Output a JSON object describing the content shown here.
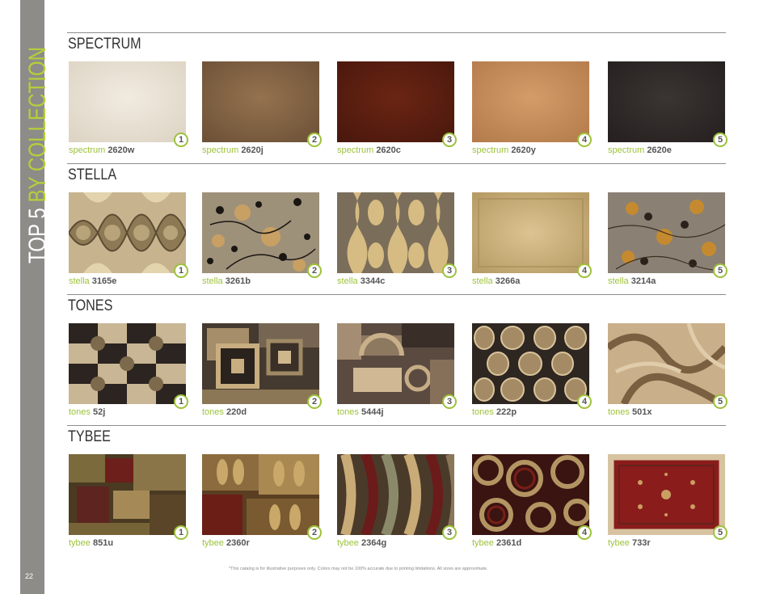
{
  "sidebar": {
    "title_part1": "TOP 5 ",
    "title_part2": "BY COLLECTION",
    "page_number": "22"
  },
  "sections": [
    {
      "title": "SPECTRUM",
      "items": [
        {
          "badge": "1",
          "collection": "spectrum",
          "sku": "2620w",
          "image": "cream-shag-rug"
        },
        {
          "badge": "2",
          "collection": "spectrum",
          "sku": "2620j",
          "image": "brown-shag-rug"
        },
        {
          "badge": "3",
          "collection": "spectrum",
          "sku": "2620c",
          "image": "rust-shag-rug"
        },
        {
          "badge": "4",
          "collection": "spectrum",
          "sku": "2620y",
          "image": "tan-shag-rug"
        },
        {
          "badge": "5",
          "collection": "spectrum",
          "sku": "2620e",
          "image": "charcoal-shag-rug"
        }
      ]
    },
    {
      "title": "STELLA",
      "items": [
        {
          "badge": "1",
          "collection": "stella",
          "sku": "3165e",
          "image": "ogee-medallion-rug"
        },
        {
          "badge": "2",
          "collection": "stella",
          "sku": "3261b",
          "image": "floral-grey-rug"
        },
        {
          "badge": "3",
          "collection": "stella",
          "sku": "3344c",
          "image": "ikat-damask-rug"
        },
        {
          "badge": "4",
          "collection": "stella",
          "sku": "3266a",
          "image": "distressed-beige-rug"
        },
        {
          "badge": "5",
          "collection": "stella",
          "sku": "3214a",
          "image": "floral-taupe-rug"
        }
      ]
    },
    {
      "title": "TONES",
      "items": [
        {
          "badge": "1",
          "collection": "tones",
          "sku": "52j",
          "image": "circle-grid-rug"
        },
        {
          "badge": "2",
          "collection": "tones",
          "sku": "220d",
          "image": "squares-rug"
        },
        {
          "badge": "3",
          "collection": "tones",
          "sku": "5444j",
          "image": "geometric-blocks-rug"
        },
        {
          "badge": "4",
          "collection": "tones",
          "sku": "222p",
          "image": "ovals-rug"
        },
        {
          "badge": "5",
          "collection": "tones",
          "sku": "501x",
          "image": "abstract-swirl-rug"
        }
      ]
    },
    {
      "title": "TYBEE",
      "items": [
        {
          "badge": "1",
          "collection": "tybee",
          "sku": "851u",
          "image": "patchwork-rug"
        },
        {
          "badge": "2",
          "collection": "tybee",
          "sku": "2360r",
          "image": "leaf-blocks-rug"
        },
        {
          "badge": "3",
          "collection": "tybee",
          "sku": "2364g",
          "image": "waves-rug"
        },
        {
          "badge": "4",
          "collection": "tybee",
          "sku": "2361d",
          "image": "rings-rug"
        },
        {
          "badge": "5",
          "collection": "tybee",
          "sku": "733r",
          "image": "persian-red-rug"
        }
      ]
    }
  ],
  "footnote": "*This catalog is for illustrative purposes only. Colors may not be 100% accurate due to printing limitations. All sizes are approximate.",
  "colors": {
    "accent": "#9dc23b",
    "sidebar": "#8d8c89",
    "heading": "#333333"
  }
}
